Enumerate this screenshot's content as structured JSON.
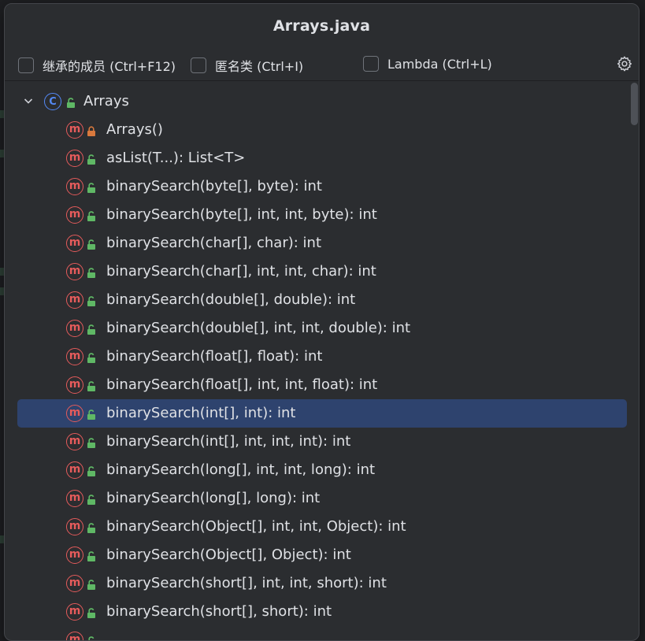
{
  "window": {
    "title": "Arrays.java"
  },
  "filters": {
    "inherited": {
      "label": "继承的成员 (Ctrl+F12)",
      "checked": false
    },
    "anonymous": {
      "label": "匿名类 (Ctrl+I)",
      "checked": false
    },
    "lambda": {
      "label": "Lambda (Ctrl+L)",
      "checked": false
    }
  },
  "icons": {
    "settings": "gear-icon",
    "expand": "chevron-down-icon",
    "class": "class-icon",
    "method": "method-icon",
    "public": "unlocked-icon",
    "private": "locked-icon"
  },
  "colors": {
    "background": "#2b2d30",
    "selection": "#2e436e",
    "text": "#dfe1e5",
    "class_icon": "#548af7",
    "method_icon": "#e55b5b",
    "public_lock": "#5fb865",
    "private_lock": "#d9793d"
  },
  "tree": {
    "root": {
      "label": "Arrays",
      "icon": "C",
      "expanded": true,
      "visibility": "public"
    },
    "members": [
      {
        "label": "Arrays()",
        "icon": "m",
        "visibility": "private",
        "selected": false
      },
      {
        "label": "asList(T...): List<T>",
        "icon": "m",
        "visibility": "public",
        "selected": false
      },
      {
        "label": "binarySearch(byte[], byte): int",
        "icon": "m",
        "visibility": "public",
        "selected": false
      },
      {
        "label": "binarySearch(byte[], int, int, byte): int",
        "icon": "m",
        "visibility": "public",
        "selected": false
      },
      {
        "label": "binarySearch(char[], char): int",
        "icon": "m",
        "visibility": "public",
        "selected": false
      },
      {
        "label": "binarySearch(char[], int, int, char): int",
        "icon": "m",
        "visibility": "public",
        "selected": false
      },
      {
        "label": "binarySearch(double[], double): int",
        "icon": "m",
        "visibility": "public",
        "selected": false
      },
      {
        "label": "binarySearch(double[], int, int, double): int",
        "icon": "m",
        "visibility": "public",
        "selected": false
      },
      {
        "label": "binarySearch(float[], float): int",
        "icon": "m",
        "visibility": "public",
        "selected": false
      },
      {
        "label": "binarySearch(float[], int, int, float): int",
        "icon": "m",
        "visibility": "public",
        "selected": false
      },
      {
        "label": "binarySearch(int[], int): int",
        "icon": "m",
        "visibility": "public",
        "selected": true
      },
      {
        "label": "binarySearch(int[], int, int, int): int",
        "icon": "m",
        "visibility": "public",
        "selected": false
      },
      {
        "label": "binarySearch(long[], int, int, long): int",
        "icon": "m",
        "visibility": "public",
        "selected": false
      },
      {
        "label": "binarySearch(long[], long): int",
        "icon": "m",
        "visibility": "public",
        "selected": false
      },
      {
        "label": "binarySearch(Object[], int, int, Object): int",
        "icon": "m",
        "visibility": "public",
        "selected": false
      },
      {
        "label": "binarySearch(Object[], Object): int",
        "icon": "m",
        "visibility": "public",
        "selected": false
      },
      {
        "label": "binarySearch(short[], int, int, short): int",
        "icon": "m",
        "visibility": "public",
        "selected": false
      },
      {
        "label": "binarySearch(short[], short): int",
        "icon": "m",
        "visibility": "public",
        "selected": false
      },
      {
        "label": "",
        "icon": "m",
        "visibility": "public",
        "selected": false
      }
    ]
  }
}
